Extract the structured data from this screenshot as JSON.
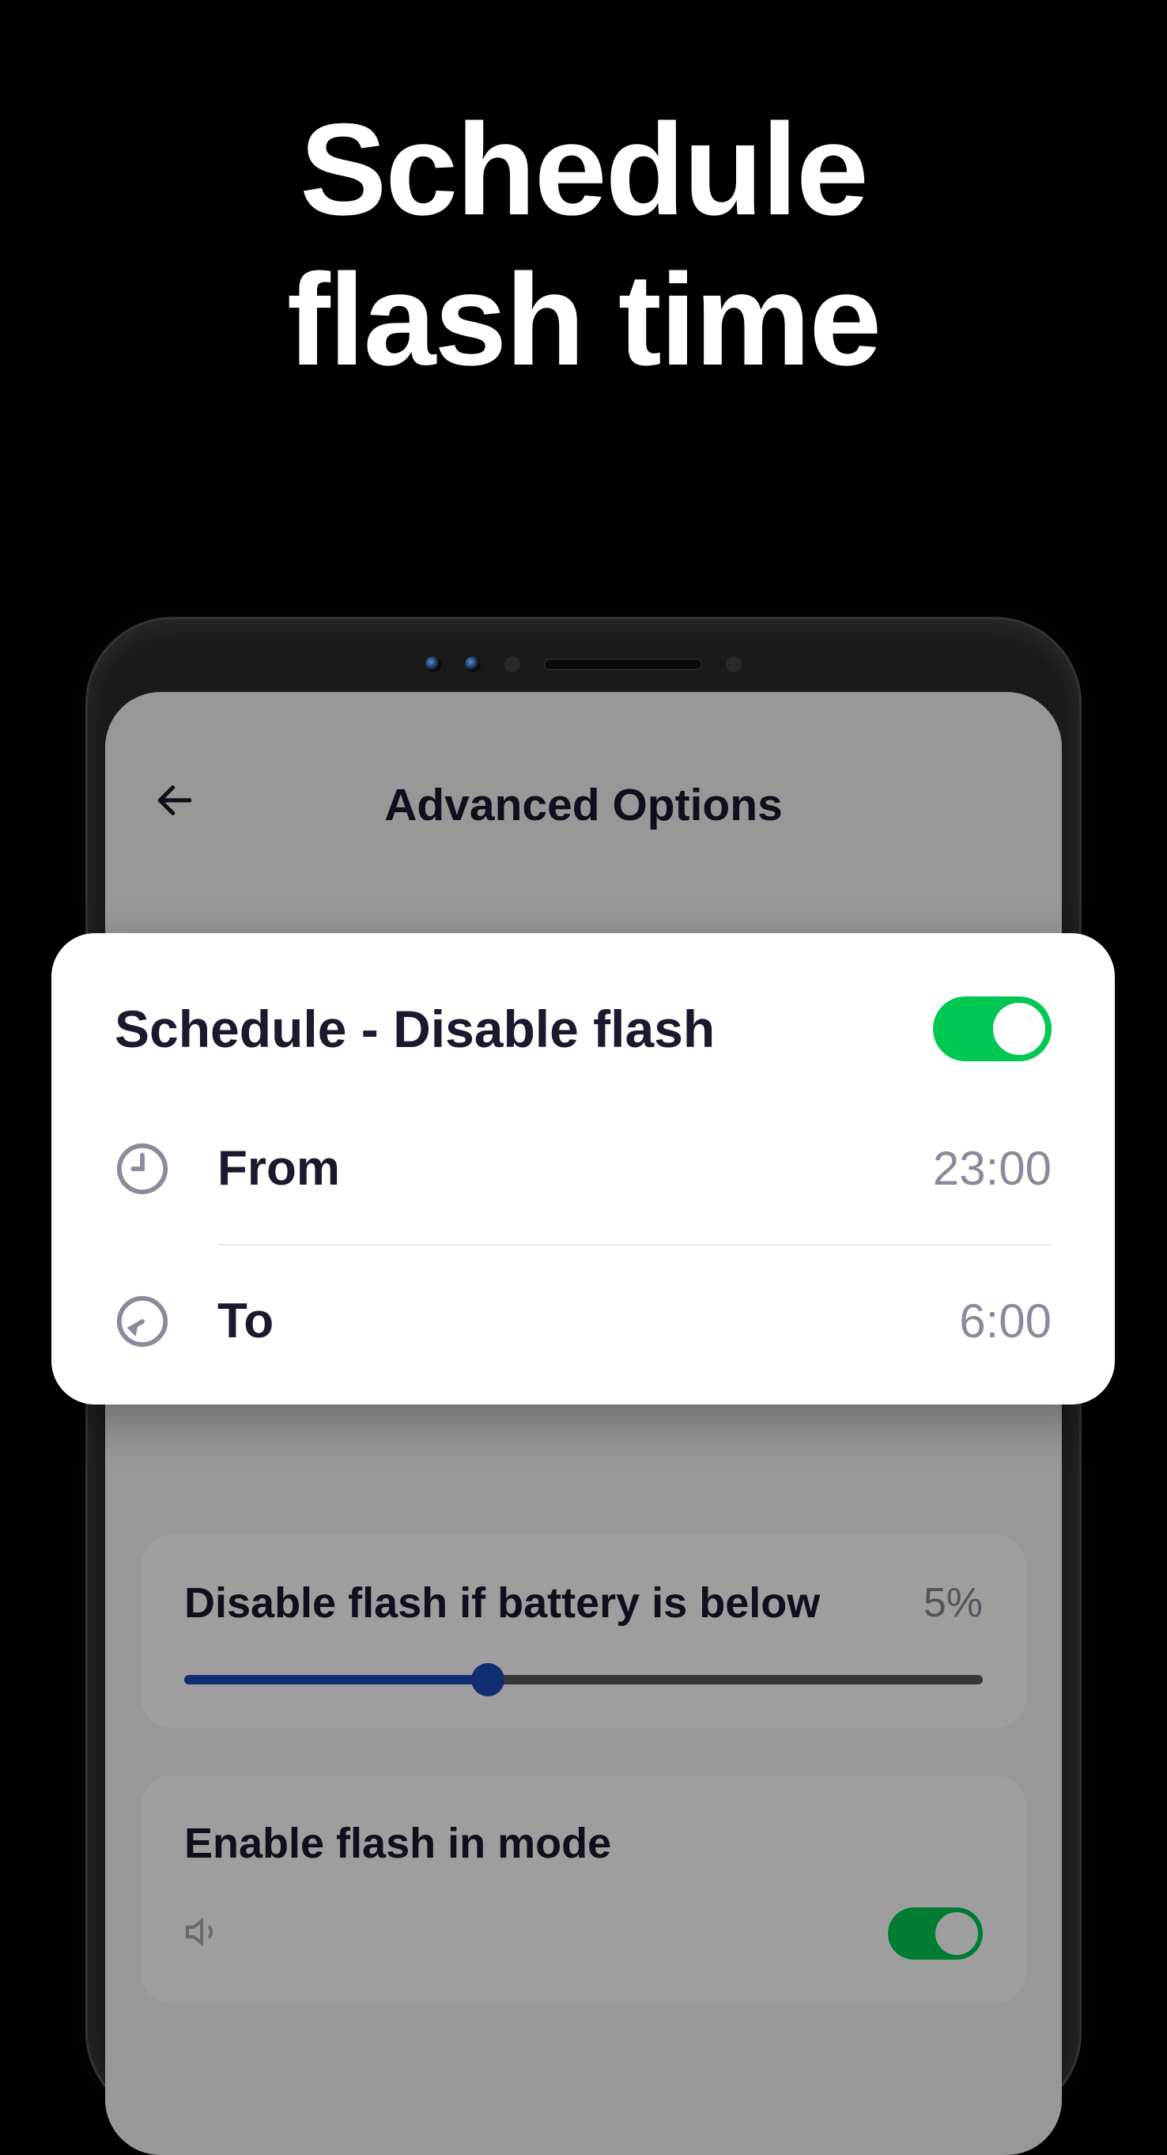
{
  "promo": {
    "title_line1": "Schedule",
    "title_line2": "flash time"
  },
  "app": {
    "header_title": "Advanced Options"
  },
  "modal": {
    "title": "Schedule - Disable flash",
    "toggle_on": true,
    "from_label": "From",
    "from_value": "23:00",
    "to_label": "To",
    "to_value": "6:00"
  },
  "battery": {
    "label": "Disable flash if battery is below",
    "value": "5%",
    "slider_percent": 38
  },
  "mode": {
    "label": "Enable flash in mode"
  },
  "colors": {
    "toggle_on": "#00c853",
    "slider": "#1e4bb8"
  }
}
